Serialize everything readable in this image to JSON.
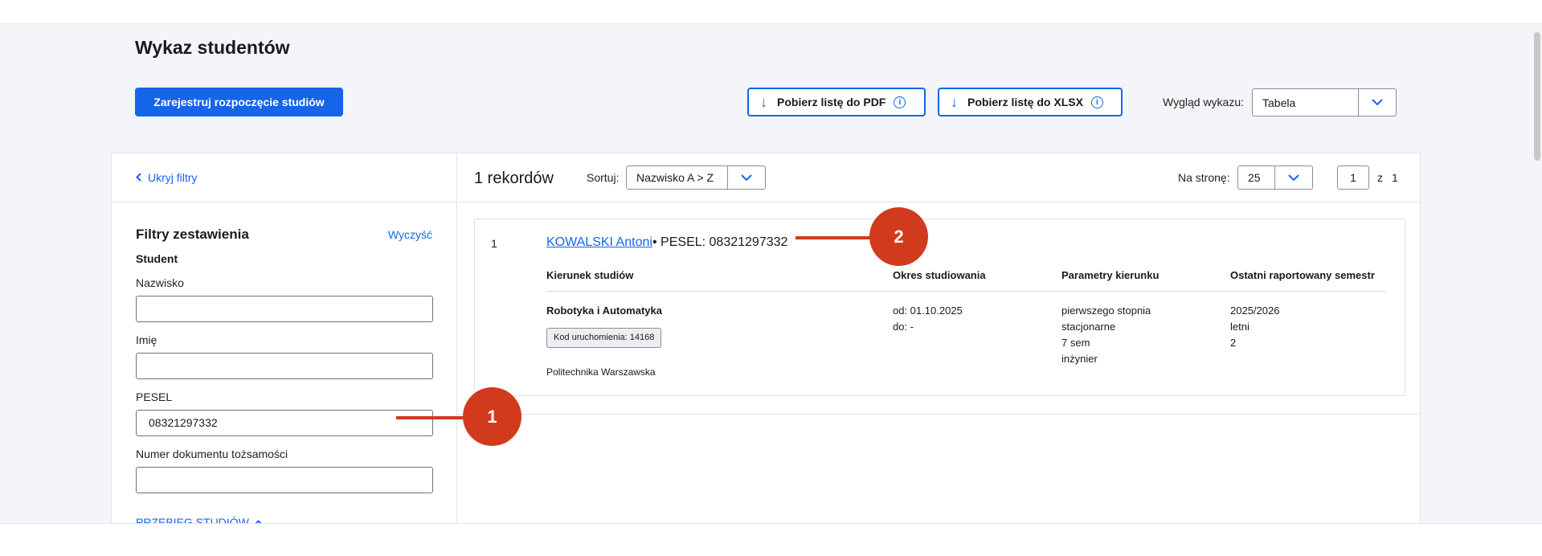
{
  "page": {
    "title": "Wykaz studentów"
  },
  "toolbar": {
    "register_label": "Zarejestruj rozpoczęcie studiów",
    "pdf_label": "Pobierz listę do PDF",
    "xlsx_label": "Pobierz listę do XLSX",
    "info_glyph": "i",
    "arrow_glyph": "↓",
    "view_label": "Wygląd wykazu:",
    "view_value": "Tabela"
  },
  "filters": {
    "hide_label": "Ukryj filtry",
    "title": "Filtry zestawienia",
    "clear_label": "Wyczyść",
    "section_student": "Student",
    "surname_label": "Nazwisko",
    "surname_value": "",
    "firstname_label": "Imię",
    "firstname_value": "",
    "pesel_label": "PESEL",
    "pesel_value": "08321297332",
    "document_label": "Numer dokumentu tożsamości",
    "document_value": "",
    "przebieg_label": "PRZEBIEG STUDIÓW"
  },
  "results": {
    "count_label": "1 rekordów",
    "sort_label": "Sortuj:",
    "sort_value": "Nazwisko A > Z",
    "perpage_label": "Na stronę:",
    "perpage_value": "25",
    "page_current": "1",
    "page_of": "z",
    "page_total": "1"
  },
  "record": {
    "index": "1",
    "name": "KOWALSKI Antoni",
    "pesel": " • PESEL: 08321297332",
    "headers": {
      "kierunek": "Kierunek studiów",
      "okres": "Okres studiowania",
      "parametry": "Parametry kierunku",
      "semestr": "Ostatni raportowany semestr"
    },
    "kierunek": "Robotyka i Automatyka",
    "kod": "Kod uruchomienia: 14168",
    "uczelnia": "Politechnika Warszawska",
    "okres_od": "od: 01.10.2025",
    "okres_do": "do: -",
    "param1": "pierwszego stopnia",
    "param2": "stacjonarne",
    "param3": "7 sem",
    "param4": "inżynier",
    "semestr1": "2025/2026",
    "semestr2": "letni",
    "semestr3": "2"
  },
  "callouts": {
    "one": "1",
    "two": "2"
  },
  "colors": {
    "accent": "#1565e8",
    "callout": "#d23a1e"
  }
}
